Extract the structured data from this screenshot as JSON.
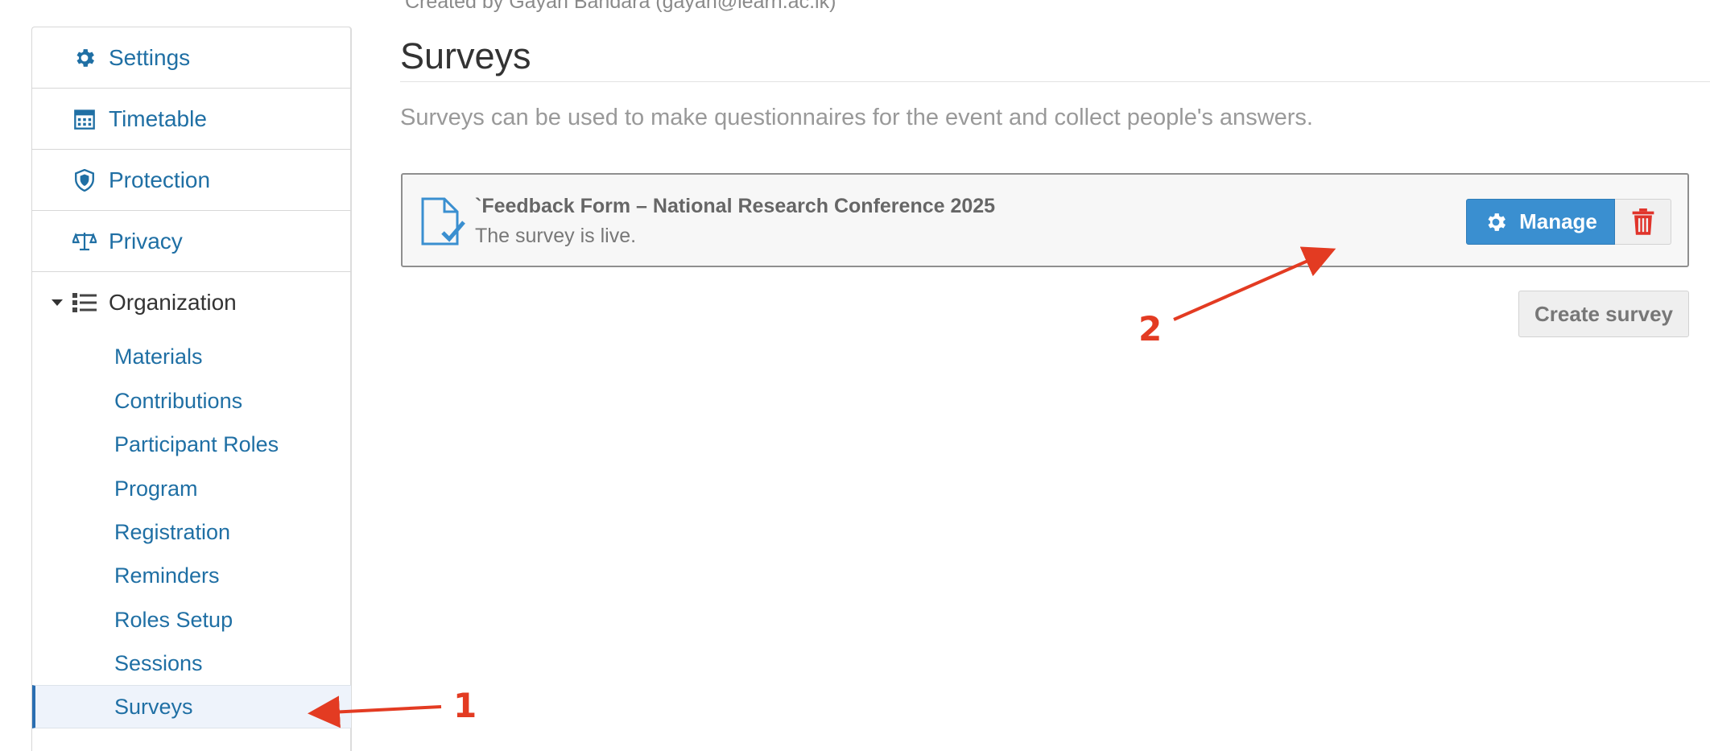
{
  "header": {
    "created_by": "Created by Gayan Bandara (gayan@learn.ac.lk)"
  },
  "sidebar": {
    "items": [
      {
        "label": "Settings",
        "icon": "gear-icon"
      },
      {
        "label": "Timetable",
        "icon": "calendar-icon"
      },
      {
        "label": "Protection",
        "icon": "shield-icon"
      },
      {
        "label": "Privacy",
        "icon": "scales-icon"
      },
      {
        "label": "Organization",
        "icon": "list-icon"
      }
    ],
    "sub_items": [
      {
        "label": "Materials"
      },
      {
        "label": "Contributions"
      },
      {
        "label": "Participant Roles"
      },
      {
        "label": "Program"
      },
      {
        "label": "Registration"
      },
      {
        "label": "Reminders"
      },
      {
        "label": "Roles Setup"
      },
      {
        "label": "Sessions"
      },
      {
        "label": "Surveys",
        "active": true
      }
    ]
  },
  "main": {
    "title": "Surveys",
    "description": "Surveys can be used to make questionnaires for the event and collect people's answers.",
    "survey": {
      "title": "`Feedback Form – National Research Conference 2025",
      "status": "The survey is live.",
      "manage_label": "Manage"
    },
    "create_label": "Create survey"
  },
  "annotations": {
    "one": "1",
    "two": "2"
  },
  "colors": {
    "link": "#1f6fa4",
    "primary": "#3a8fd0",
    "danger": "#e0342b",
    "annotation": "#e33b22",
    "active_bg": "#eef3fb"
  }
}
